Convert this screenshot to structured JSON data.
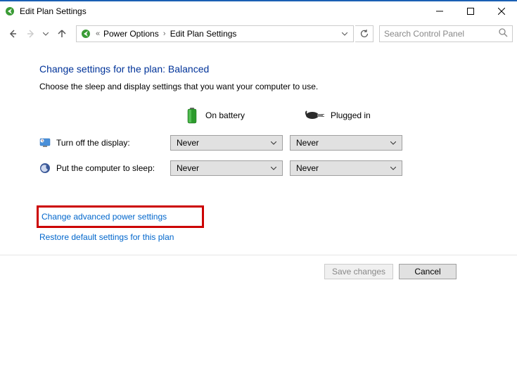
{
  "window": {
    "title": "Edit Plan Settings"
  },
  "breadcrumb": {
    "items": [
      "Power Options",
      "Edit Plan Settings"
    ]
  },
  "search": {
    "placeholder": "Search Control Panel"
  },
  "heading": "Change settings for the plan: Balanced",
  "subtext": "Choose the sleep and display settings that you want your computer to use.",
  "columns": {
    "battery": "On battery",
    "plugged": "Plugged in"
  },
  "settings": [
    {
      "label": "Turn off the display:",
      "battery_value": "Never",
      "plugged_value": "Never"
    },
    {
      "label": "Put the computer to sleep:",
      "battery_value": "Never",
      "plugged_value": "Never"
    }
  ],
  "links": {
    "advanced": "Change advanced power settings",
    "restore": "Restore default settings for this plan"
  },
  "buttons": {
    "save": "Save changes",
    "cancel": "Cancel"
  }
}
